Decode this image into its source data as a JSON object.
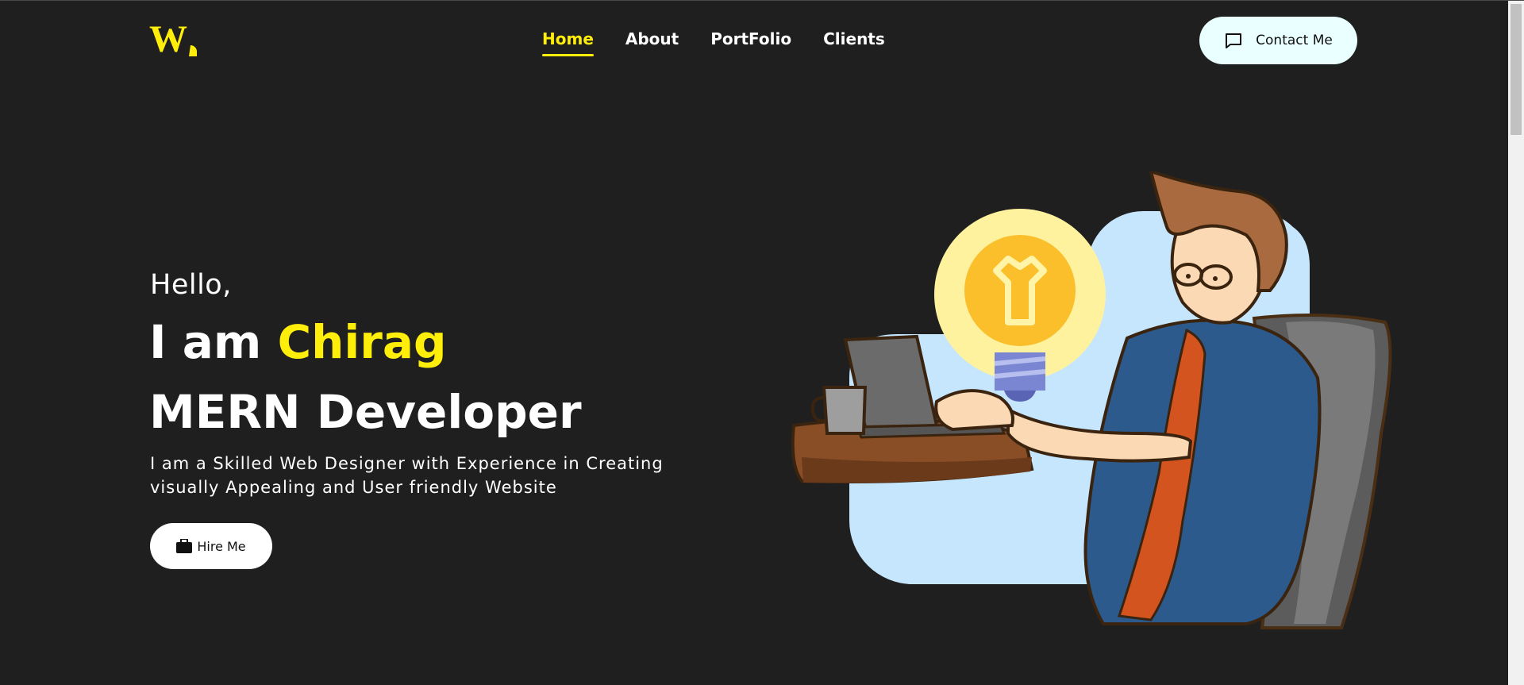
{
  "header": {
    "logo_alt": "W logo",
    "nav": [
      {
        "label": "Home",
        "active": true
      },
      {
        "label": "About",
        "active": false
      },
      {
        "label": "PortFolio",
        "active": false
      },
      {
        "label": "Clients",
        "active": false
      }
    ],
    "contact_label": "Contact Me",
    "contact_icon": "chat-bubble-icon"
  },
  "hero": {
    "greeting": "Hello,",
    "intro_prefix": "I am",
    "name": "Chirag",
    "role": "MERN Developer",
    "description": "I am a Skilled Web Designer with Experience in Creating visually Appealing and User friendly Website",
    "hire_label": "Hire Me",
    "hire_icon": "briefcase-icon"
  },
  "colors": {
    "background": "#1f1f1f",
    "accent": "#ffee0a",
    "contact_bg": "#eaffff"
  }
}
